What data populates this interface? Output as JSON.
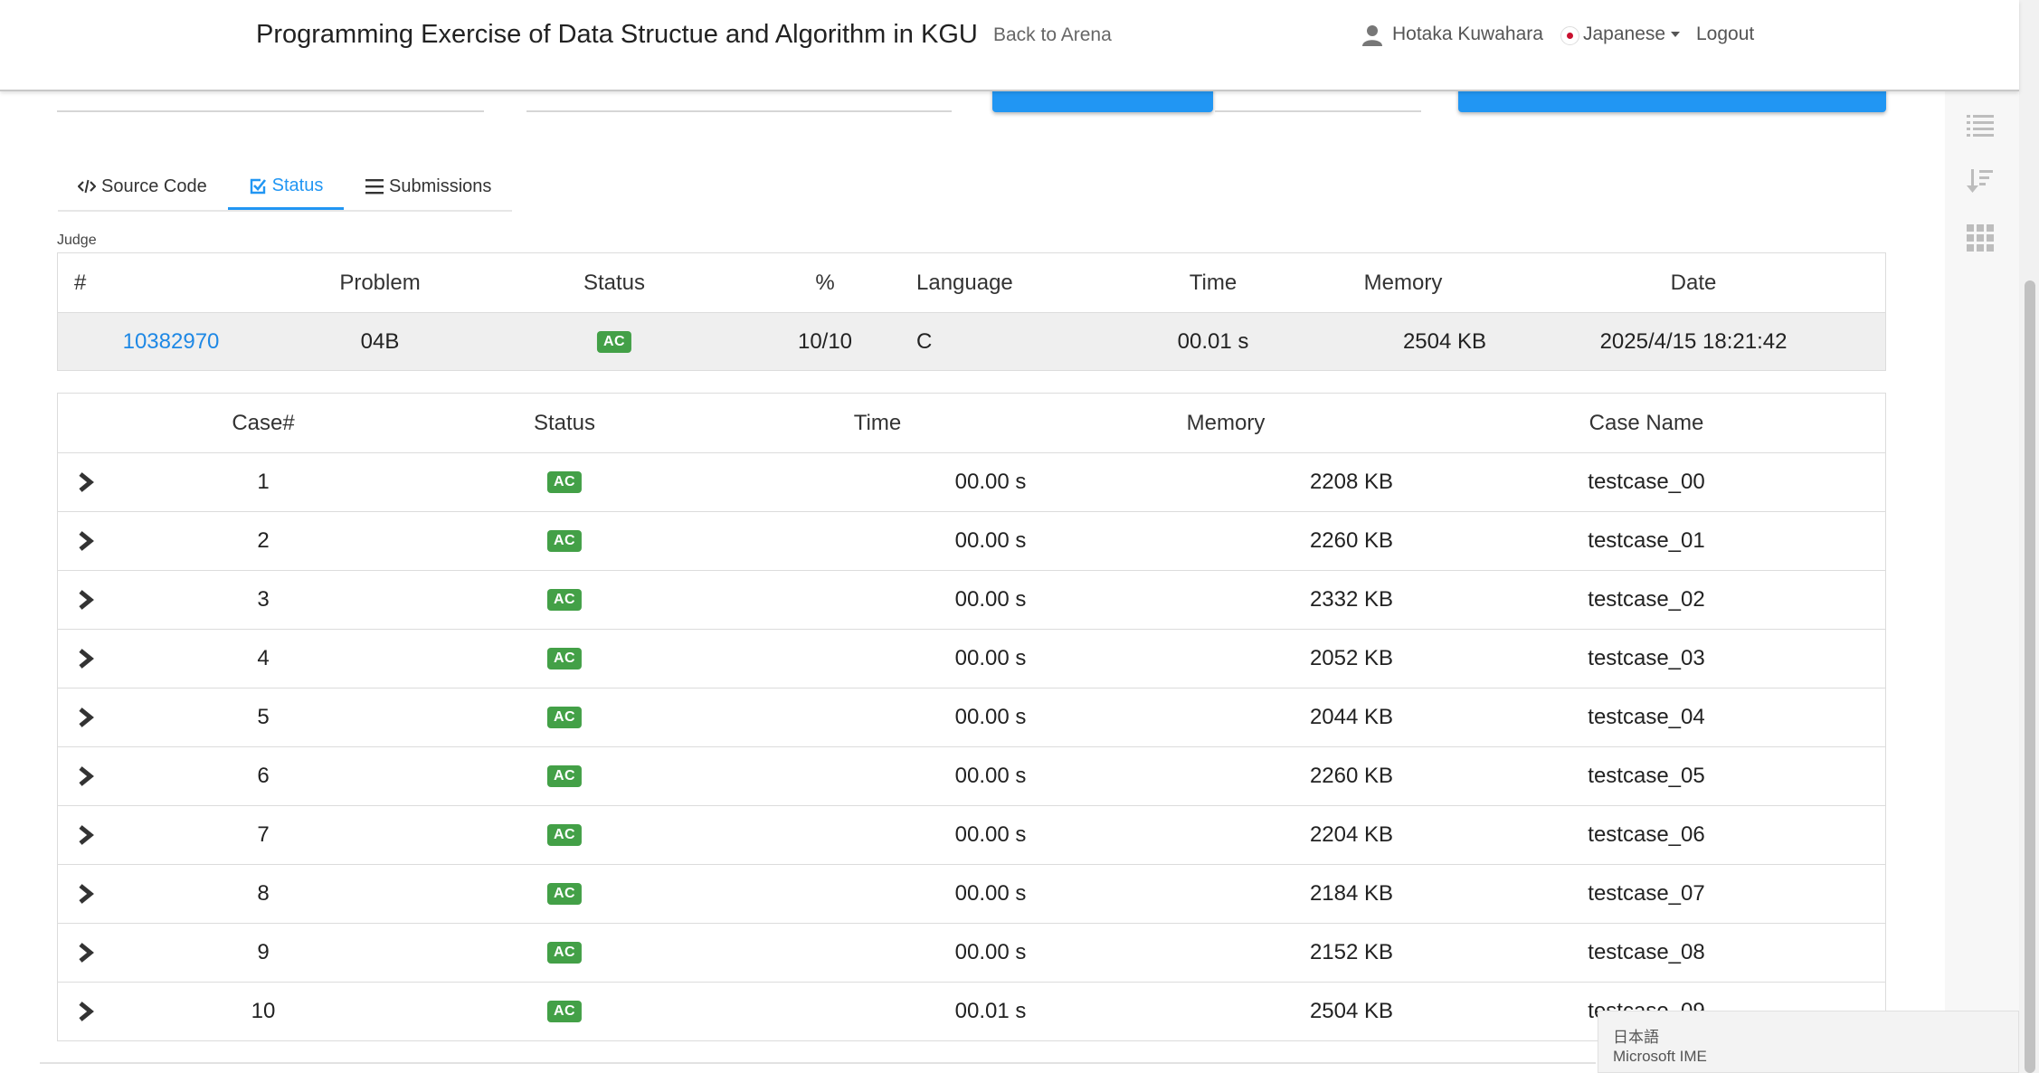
{
  "header": {
    "title": "Programming Exercise of Data Structue and Algorithm in KGU",
    "back_link": "Back to Arena",
    "user_name": "Hotaka Kuwahara",
    "language": "Japanese",
    "logout": "Logout"
  },
  "tabs": [
    {
      "label": "Source Code",
      "icon": "code-icon",
      "active": false
    },
    {
      "label": "Status",
      "icon": "check-square-icon",
      "active": true
    },
    {
      "label": "Submissions",
      "icon": "list-icon",
      "active": false
    }
  ],
  "judge": {
    "label": "Judge",
    "headers": [
      "#",
      "Problem",
      "Status",
      "%",
      "Language",
      "Time",
      "Memory",
      "Date"
    ],
    "row": {
      "id": "10382970",
      "problem": "04B",
      "status": "AC",
      "percent": "10/10",
      "language": "C",
      "time": "00.01 s",
      "memory": "2504 KB",
      "date": "2025/4/15 18:21:42"
    }
  },
  "cases": {
    "headers": [
      "Case#",
      "Status",
      "Time",
      "Memory",
      "Case Name"
    ],
    "rows": [
      {
        "num": "1",
        "status": "AC",
        "time": "00.00 s",
        "memory": "2208 KB",
        "name": "testcase_00"
      },
      {
        "num": "2",
        "status": "AC",
        "time": "00.00 s",
        "memory": "2260 KB",
        "name": "testcase_01"
      },
      {
        "num": "3",
        "status": "AC",
        "time": "00.00 s",
        "memory": "2332 KB",
        "name": "testcase_02"
      },
      {
        "num": "4",
        "status": "AC",
        "time": "00.00 s",
        "memory": "2052 KB",
        "name": "testcase_03"
      },
      {
        "num": "5",
        "status": "AC",
        "time": "00.00 s",
        "memory": "2044 KB",
        "name": "testcase_04"
      },
      {
        "num": "6",
        "status": "AC",
        "time": "00.00 s",
        "memory": "2260 KB",
        "name": "testcase_05"
      },
      {
        "num": "7",
        "status": "AC",
        "time": "00.00 s",
        "memory": "2204 KB",
        "name": "testcase_06"
      },
      {
        "num": "8",
        "status": "AC",
        "time": "00.00 s",
        "memory": "2184 KB",
        "name": "testcase_07"
      },
      {
        "num": "9",
        "status": "AC",
        "time": "00.00 s",
        "memory": "2152 KB",
        "name": "testcase_08"
      },
      {
        "num": "10",
        "status": "AC",
        "time": "00.01 s",
        "memory": "2504 KB",
        "name": "testcase_09"
      }
    ]
  },
  "ime": {
    "line1": "日本語",
    "line2": "Microsoft IME"
  },
  "colors": {
    "accent": "#2196f3",
    "ac_badge": "#43a047",
    "link": "#1e88e5"
  }
}
